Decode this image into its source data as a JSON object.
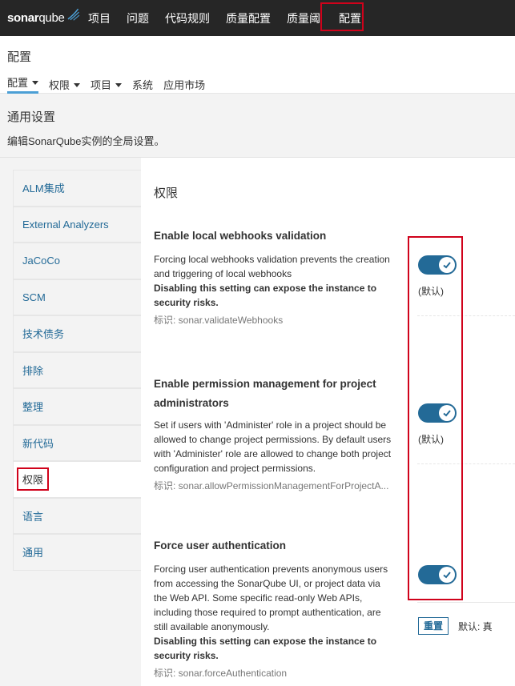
{
  "topnav": {
    "logo_main": "sonar",
    "logo_suffix": "qube",
    "items": [
      "项目",
      "问题",
      "代码规则",
      "质量配置",
      "质量阈",
      "配置"
    ]
  },
  "page": {
    "title": "配置",
    "subnav": [
      {
        "label": "配置",
        "dropdown": true
      },
      {
        "label": "权限",
        "dropdown": true
      },
      {
        "label": "项目",
        "dropdown": true
      },
      {
        "label": "系统",
        "dropdown": false
      },
      {
        "label": "应用市场",
        "dropdown": false
      }
    ]
  },
  "settings": {
    "title": "通用设置",
    "description": "编辑SonarQube实例的全局设置。"
  },
  "sidebar": {
    "items": [
      "ALM集成",
      "External Analyzers",
      "JaCoCo",
      "SCM",
      "技术债务",
      "排除",
      "整理",
      "新代码",
      "权限",
      "语言",
      "通用"
    ]
  },
  "main": {
    "heading": "权限",
    "settings": [
      {
        "title": "Enable local webhooks validation",
        "desc": "Forcing local webhooks validation prevents the creation and triggering of local webhooks",
        "warning": "Disabling this setting can expose the instance to security risks.",
        "key": "标识: sonar.validateWebhooks",
        "value": true,
        "default_label": "(默认)"
      },
      {
        "title": "Enable permission management for project administrators",
        "desc": "Set if users with 'Administer' role in a project should be allowed to change project permissions. By default users with 'Administer' role are allowed to change both project configuration and project permissions.",
        "warning": "",
        "key": "标识: sonar.allowPermissionManagementForProjectA...",
        "value": true,
        "default_label": "(默认)"
      },
      {
        "title": "Force user authentication",
        "desc": "Forcing user authentication prevents anonymous users from accessing the SonarQube UI, or project data via the Web API. Some specific read-only Web APIs, including those required to prompt authentication, are still available anonymously.",
        "warning": "Disabling this setting can expose the instance to security risks.",
        "key": "标识: sonar.forceAuthentication",
        "value": true,
        "reset_label": "重置",
        "default_text": "默认: 真"
      }
    ]
  },
  "colors": {
    "topnav_bg": "#262626",
    "accent": "#236a97",
    "highlight_box": "#d0021b"
  }
}
